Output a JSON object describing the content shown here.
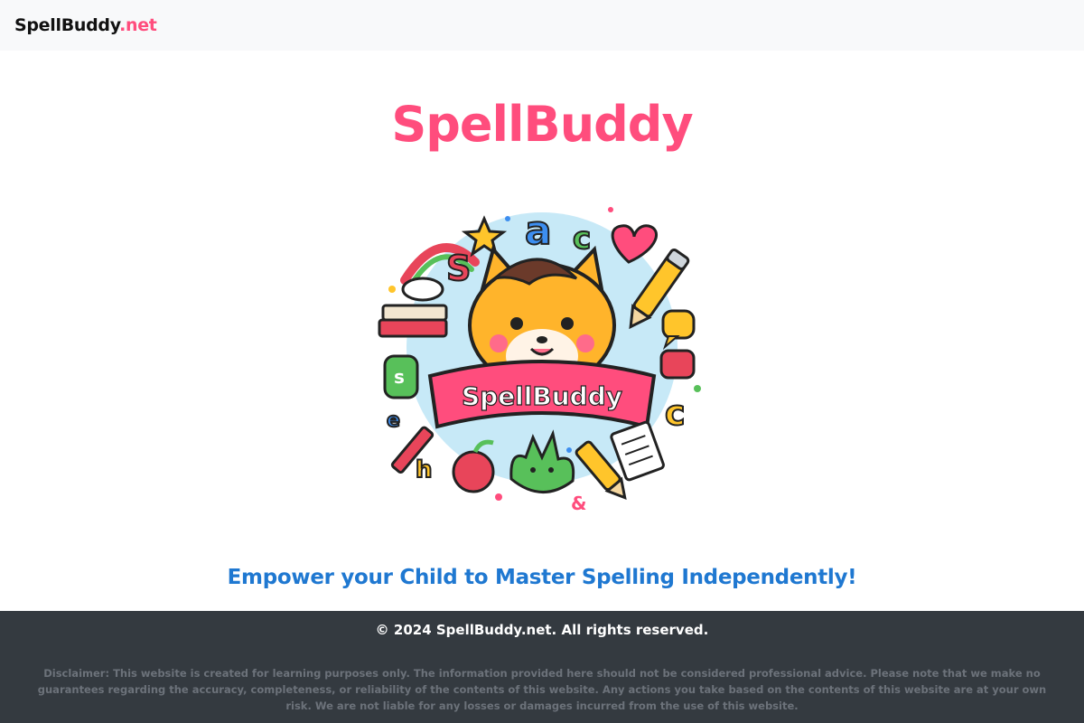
{
  "navbar": {
    "brand_name": "SpellBuddy",
    "brand_tld": ".net"
  },
  "hero": {
    "title": "SpellBuddy",
    "logo_banner_text": "SpellBuddy",
    "tagline": "Empower your Child to Master Spelling Independently!"
  },
  "footer": {
    "copyright": "© 2024 SpellBuddy.net. All rights reserved.",
    "disclaimer": "Disclaimer: This website is created for learning purposes only. The information provided here should not be considered professional advice. Please note that we make no guarantees regarding the accuracy, completeness, or reliability of the contents of this website. Any actions you take based on the contents of this website are at your own risk. We are not liable for any losses or damages incurred from the use of this website."
  },
  "colors": {
    "brand_pink": "#ff4d7d",
    "tagline_blue": "#1f78d1",
    "navbar_bg": "#f8f9fa",
    "footer_bg": "#343a40"
  }
}
